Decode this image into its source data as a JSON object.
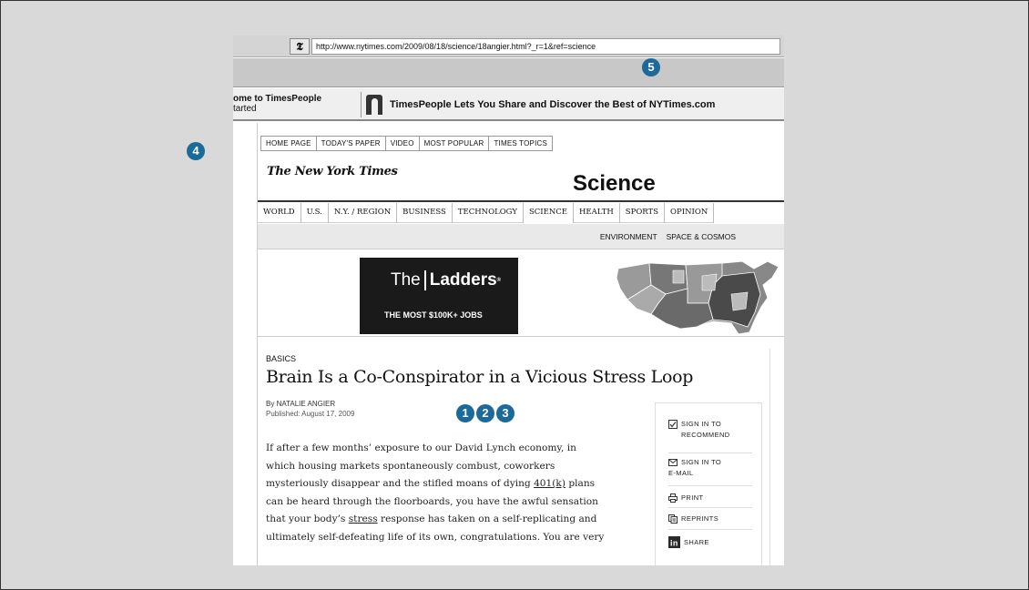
{
  "browser": {
    "address_icon": "𝕿",
    "url": "http://www.nytimes.com/2009/08/18/science/18angier.html?_r=1&ref=science"
  },
  "timespeople": {
    "welcome": "ome to TimesPeople",
    "started": "tarted",
    "tagline": "TimesPeople Lets You Share and Discover the Best of NYTimes.com"
  },
  "top_nav": [
    "HOME PAGE",
    "TODAY'S PAPER",
    "VIDEO",
    "MOST POPULAR",
    "TIMES TOPICS"
  ],
  "masthead": "The New York Times",
  "section_title": "Science",
  "section_nav": [
    "WORLD",
    "U.S.",
    "N.Y. / REGION",
    "BUSINESS",
    "TECHNOLOGY",
    "SCIENCE",
    "HEALTH",
    "SPORTS",
    "OPINION"
  ],
  "sub_nav": [
    "ENVIRONMENT",
    "SPACE & COSMOS"
  ],
  "ad": {
    "brand_the": "The",
    "brand_name": "Ladders",
    "tagline": "THE MOST $100K+ JOBS"
  },
  "article": {
    "kicker": "BASICS",
    "headline": "Brain Is a Co-Conspirator in a Vicious Stress Loop",
    "byline_prefix": "By ",
    "author": "NATALIE ANGIER",
    "published": "Published: August 17, 2009",
    "lines": [
      [
        "If after a few months’ exposure to our David Lynch economy, in"
      ],
      [
        "which housing markets spontaneously combust, coworkers"
      ],
      [
        "mysteriously disappear and the stifled moans of dying ",
        "401(k)",
        " plans"
      ],
      [
        "can be heard through the floorboards, you have the awful sensation"
      ],
      [
        "that your body’s ",
        "stress",
        " response has taken on a self-replicating and"
      ],
      [
        "ultimately self-defeating life of its own, congratulations. You are very"
      ]
    ]
  },
  "tools": {
    "recommend_1": "SIGN IN TO",
    "recommend_2": "RECOMMEND",
    "email_1": "SIGN IN TO",
    "email_2": "E-MAIL",
    "print": "PRINT",
    "reprints": "REPRINTS",
    "share": "SHARE"
  },
  "callouts": [
    "1",
    "2",
    "3",
    "4",
    "5"
  ],
  "colors": {
    "callout": "#1b6a9a",
    "background": "#d9d9d9",
    "ad": "#1a1a1a"
  }
}
